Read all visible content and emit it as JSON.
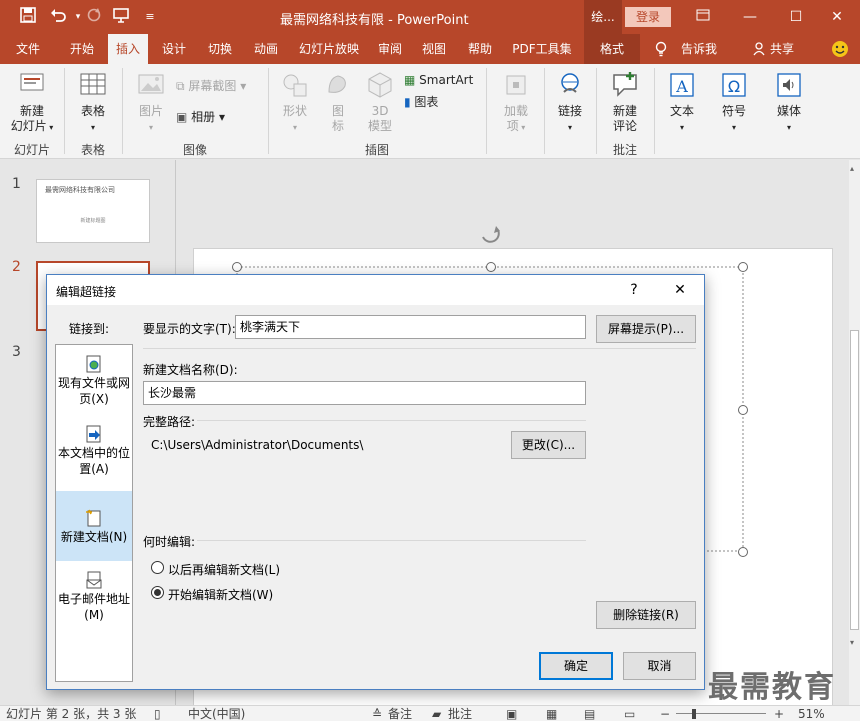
{
  "app": {
    "title": "最需网络科技有限   -   PowerPoint",
    "context_title": "绘...",
    "login_label": "登录",
    "window_controls": [
      "restore-icon",
      "minimize-icon",
      "maximize-icon",
      "close-icon"
    ]
  },
  "quick_access": [
    "save-icon",
    "undo-icon",
    "redo-icon",
    "present-icon",
    "customize-icon"
  ],
  "tabs": [
    {
      "label": "文件"
    },
    {
      "label": "开始"
    },
    {
      "label": "插入"
    },
    {
      "label": "设计"
    },
    {
      "label": "切换"
    },
    {
      "label": "动画"
    },
    {
      "label": "幻灯片放映"
    },
    {
      "label": "审阅"
    },
    {
      "label": "视图"
    },
    {
      "label": "帮助"
    },
    {
      "label": "PDF工具集"
    },
    {
      "label": "格式"
    }
  ],
  "tab_extras": {
    "tell_me": "告诉我",
    "share": "共享"
  },
  "ribbon": {
    "new_slide": "新建\n幻灯片",
    "table": "表格",
    "picture": "图片",
    "screenshot": "屏幕截图",
    "album": "相册",
    "shapes": "形状",
    "icons": "图\n标",
    "model3d": "3D\n模型",
    "smartart": "SmartArt",
    "chart": "图表",
    "addins": "加载\n项",
    "link": "链接",
    "new_comment": "新建\n评论",
    "text": "文本",
    "symbol": "符号",
    "media": "媒体",
    "groups": {
      "slides": "幻灯片",
      "tables": "表格",
      "images": "图像",
      "illustrations": "插图",
      "comments": "批注"
    }
  },
  "thumbnails": [
    {
      "number": "1",
      "title": "最需网络科技有限公司",
      "subtitle": "新建标题图"
    },
    {
      "number": "2"
    },
    {
      "number": "3"
    }
  ],
  "dialog": {
    "title": "编辑超链接",
    "help": "?",
    "close": "✕",
    "link_to_label": "链接到:",
    "link_to_items": [
      {
        "label": "现有文件或网\n页(X)",
        "icon": "web-page-icon"
      },
      {
        "label": "本文档中的位\n置(A)",
        "icon": "place-in-document-icon"
      },
      {
        "label": "新建文档(N)",
        "icon": "new-document-icon"
      },
      {
        "label": "电子邮件地址\n(M)",
        "icon": "email-icon"
      }
    ],
    "display_text_label": "要显示的文字(T):",
    "display_text_value": "桃李满天下",
    "screen_tip_button": "屏幕提示(P)...",
    "new_doc_name_label": "新建文档名称(D):",
    "new_doc_name_value": "长沙最需",
    "full_path_label": "完整路径:",
    "full_path_value": "C:\\Users\\Administrator\\Documents\\",
    "change_button": "更改(C)...",
    "when_to_edit_label": "何时编辑:",
    "edit_later": "以后再编辑新文档(L)",
    "edit_now": "开始编辑新文档(W)",
    "remove_link_button": "删除链接(R)",
    "ok_button": "确定",
    "cancel_button": "取消"
  },
  "status": {
    "slide_info": "幻灯片 第 2 张，共 3 张",
    "language": "中文(中国)",
    "notes": "备注",
    "comments": "批注",
    "zoom": "51%"
  },
  "watermark": "最需教育",
  "colors": {
    "accent": "#b7472a",
    "selection": "#cce4f7",
    "focus": "#0078d7"
  }
}
